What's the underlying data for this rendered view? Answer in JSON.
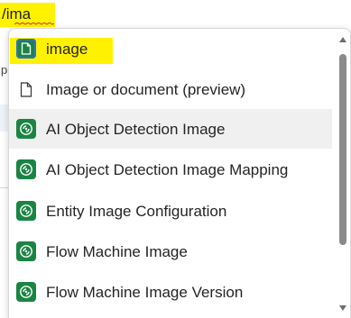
{
  "command": {
    "typed_text": "/ima"
  },
  "underlay": {
    "partial_text": "p"
  },
  "suggestions": {
    "items": [
      {
        "label": "image",
        "icon": "document-icon",
        "highlighted": true
      },
      {
        "label": "Image or document (preview)",
        "icon": "document-outline-icon"
      },
      {
        "label": "AI Object Detection Image",
        "icon": "entity-icon",
        "hover": true
      },
      {
        "label": "AI Object Detection Image Mapping",
        "icon": "entity-icon"
      },
      {
        "label": "Entity Image Configuration",
        "icon": "entity-icon"
      },
      {
        "label": "Flow Machine Image",
        "icon": "entity-icon"
      },
      {
        "label": "Flow Machine Image Version",
        "icon": "entity-icon"
      }
    ]
  },
  "colors": {
    "highlight": "#fff200",
    "entity_icon_bg": "#1b8444",
    "hover_bg": "#f0f0f0",
    "scroll_thumb": "#8a8a8a"
  }
}
